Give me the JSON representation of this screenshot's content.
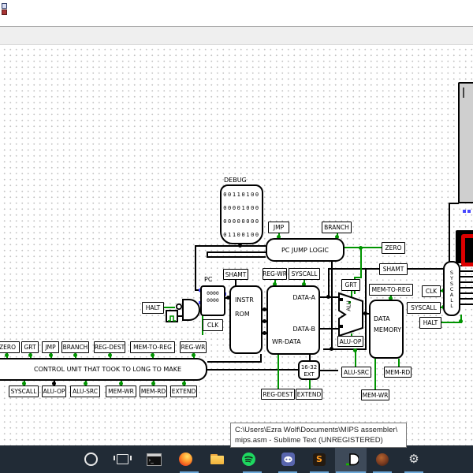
{
  "canvas": {
    "debug_probe": {
      "label": "DEBUG",
      "rows": [
        "00110100",
        "00001000",
        "00000000",
        "01100100"
      ]
    },
    "pc_register": {
      "label": "PC",
      "line1": "0000",
      "line2": "0000"
    },
    "pc_jump_logic": "PC JUMP LOGIC",
    "instr_rom": {
      "line1": "INSTR",
      "line2": "ROM"
    },
    "reg_file": {
      "data_a": "DATA-A",
      "data_b": "DATA-B",
      "wr_data": "WR-DATA"
    },
    "alu_label": "ALU",
    "data_memory": {
      "line1": "DATA",
      "line2": "MEMORY"
    },
    "extender": {
      "line1": "16-32",
      "line2": "EXT"
    },
    "control_unit": "CONTROL UNIT THAT TOOK TO LONG TO MAKE",
    "syscall_unit": "SYSCALL",
    "tunnels": {
      "zero": "ZERO",
      "grt": "GRT",
      "jmp": "JMP",
      "branch": "BRANCH",
      "reg_dest": "REG-DEST",
      "mem_to_reg": "MEM-TO-REG",
      "reg_wr": "REG-WR",
      "syscall": "SYSCALL",
      "alu_op": "ALU-OP",
      "alu_src": "ALU-SRC",
      "mem_wr": "MEM-WR",
      "mem_rd": "MEM-RD",
      "extend": "EXTEND",
      "shamt": "SHAMT",
      "clk": "CLK",
      "halt": "HALT"
    }
  },
  "tooltip": {
    "line1": "C:\\Users\\Ezra Wolf\\Documents\\MIPS assembler\\",
    "line2": "mips.asm - Sublime Text (UNREGISTERED)"
  },
  "taskbar": {
    "icons": [
      "cortana",
      "task-view",
      "terminal",
      "firefox",
      "file-explorer",
      "spotify",
      "discord",
      "sublime-text",
      "logisim",
      "planet-app",
      "settings"
    ],
    "active_app": "logisim",
    "sublime_glyph": "S",
    "terminal_glyph": "›_"
  },
  "colors": {
    "wire_green": "#009400",
    "taskbar_bg": "#212b36",
    "underline_blue": "#6da8d8",
    "display_red": "#dd0000",
    "pin_blue": "#4747ff"
  }
}
